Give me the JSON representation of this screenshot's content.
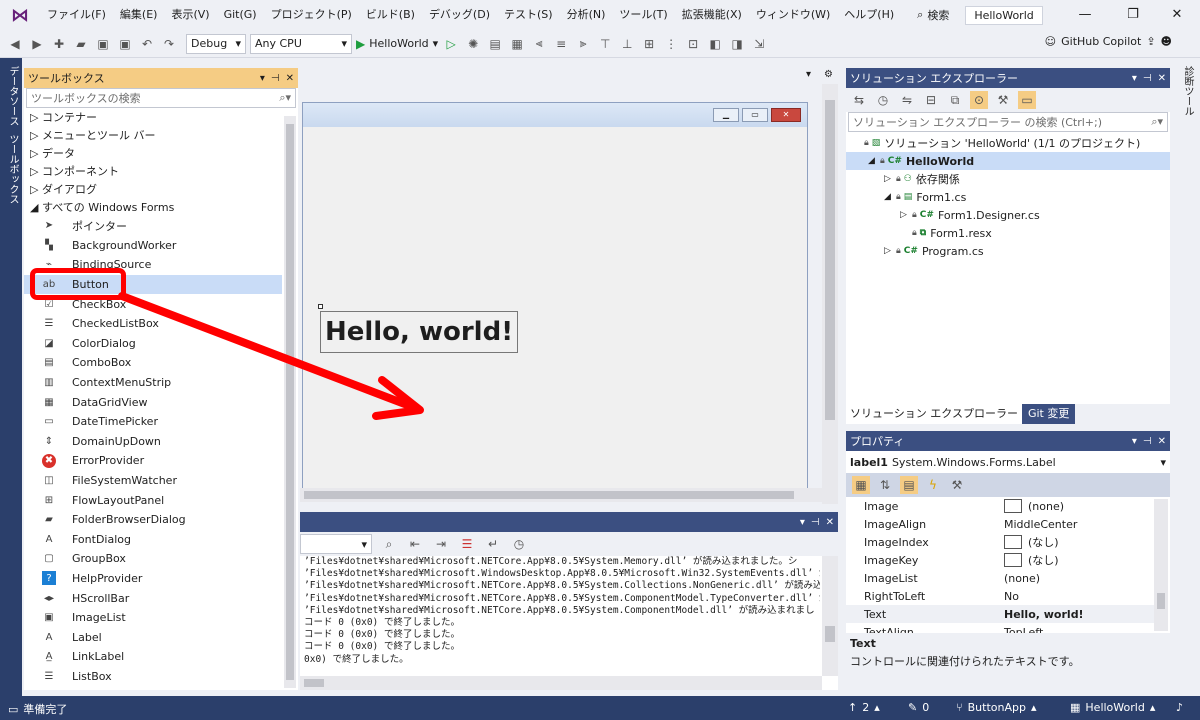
{
  "menu": {
    "items": [
      "ファイル(F)",
      "編集(E)",
      "表示(V)",
      "Git(G)",
      "プロジェクト(P)",
      "ビルド(B)",
      "デバッグ(D)",
      "テスト(S)",
      "分析(N)",
      "ツール(T)",
      "拡張機能(X)",
      "ウィンドウ(W)",
      "ヘルプ(H)"
    ],
    "search_label": "検索",
    "project_name": "HelloWorld"
  },
  "toolbar": {
    "config": "Debug",
    "platform": "Any CPU",
    "run_label": "HelloWorld",
    "copilot": "GitHub Copilot"
  },
  "left_strip": {
    "data_sources": "データソース",
    "toolbox": "ツールボックス"
  },
  "right_strip": {
    "diagnostic": "診断ツール"
  },
  "toolbox": {
    "title": "ツールボックス",
    "search_placeholder": "ツールボックスの検索",
    "categories": [
      "コンテナー",
      "メニューとツール バー",
      "データ",
      "コンポーネント",
      "ダイアログ"
    ],
    "group": "すべての Windows Forms",
    "items": [
      {
        "label": "ポインター",
        "icon": "pointer-icon"
      },
      {
        "label": "BackgroundWorker",
        "icon": "backgroundworker-icon"
      },
      {
        "label": "BindingSource",
        "icon": "bindingsource-icon"
      },
      {
        "label": "Button",
        "icon": "button-icon"
      },
      {
        "label": "CheckBox",
        "icon": "checkbox-icon"
      },
      {
        "label": "CheckedListBox",
        "icon": "checkedlistbox-icon"
      },
      {
        "label": "ColorDialog",
        "icon": "colordialog-icon"
      },
      {
        "label": "ComboBox",
        "icon": "combobox-icon"
      },
      {
        "label": "ContextMenuStrip",
        "icon": "contextmenustrip-icon"
      },
      {
        "label": "DataGridView",
        "icon": "datagridview-icon"
      },
      {
        "label": "DateTimePicker",
        "icon": "datetimepicker-icon"
      },
      {
        "label": "DomainUpDown",
        "icon": "domainupdown-icon"
      },
      {
        "label": "ErrorProvider",
        "icon": "errorprovider-icon"
      },
      {
        "label": "FileSystemWatcher",
        "icon": "filesystemwatcher-icon"
      },
      {
        "label": "FlowLayoutPanel",
        "icon": "flowlayoutpanel-icon"
      },
      {
        "label": "FolderBrowserDialog",
        "icon": "folderbrowserdialog-icon"
      },
      {
        "label": "FontDialog",
        "icon": "fontdialog-icon"
      },
      {
        "label": "GroupBox",
        "icon": "groupbox-icon"
      },
      {
        "label": "HelpProvider",
        "icon": "helpprovider-icon"
      },
      {
        "label": "HScrollBar",
        "icon": "hscrollbar-icon"
      },
      {
        "label": "ImageList",
        "icon": "imagelist-icon"
      },
      {
        "label": "Label",
        "icon": "label-icon"
      },
      {
        "label": "LinkLabel",
        "icon": "linklabel-icon"
      },
      {
        "label": "ListBox",
        "icon": "listbox-icon"
      }
    ]
  },
  "designer": {
    "label_text": "Hello, world!"
  },
  "output": {
    "lines": [
      "’Files¥dotnet¥shared¥Microsoft.NETCore.App¥8.0.5¥System.Memory.dll’ が読み込まれました。シ",
      "’Files¥dotnet¥shared¥Microsoft.WindowsDesktop.App¥8.0.5¥Microsoft.Win32.SystemEvents.dll’ が",
      "’Files¥dotnet¥shared¥Microsoft.NETCore.App¥8.0.5¥System.Collections.NonGeneric.dll’ が読み込",
      "’Files¥dotnet¥shared¥Microsoft.NETCore.App¥8.0.5¥System.ComponentModel.TypeConverter.dll’ が",
      "’Files¥dotnet¥shared¥Microsoft.NETCore.App¥8.0.5¥System.ComponentModel.dll’ が読み込まれまし",
      "コード 0 (0x0) で終了しました。",
      "コード 0 (0x0) で終了しました。",
      "コード 0 (0x0) で終了しました。",
      "0x0) で終了しました。"
    ]
  },
  "solution": {
    "title": "ソリューション エクスプローラー",
    "search_placeholder": "ソリューション エクスプローラー の検索 (Ctrl+;)",
    "tree": [
      {
        "label": "ソリューション 'HelloWorld' (1/1 のプロジェクト)",
        "indent": 0,
        "icon": "solution-icon"
      },
      {
        "label": "HelloWorld",
        "indent": 1,
        "icon": "csharp-project-icon",
        "bold": true
      },
      {
        "label": "依存関係",
        "indent": 2,
        "icon": "dependencies-icon"
      },
      {
        "label": "Form1.cs",
        "indent": 2,
        "icon": "form-icon"
      },
      {
        "label": "Form1.Designer.cs",
        "indent": 3,
        "icon": "csharp-file-icon"
      },
      {
        "label": "Form1.resx",
        "indent": 3,
        "icon": "resx-icon"
      },
      {
        "label": "Program.cs",
        "indent": 2,
        "icon": "csharp-file-icon"
      }
    ],
    "tabs": [
      "ソリューション エクスプローラー",
      "Git 変更"
    ]
  },
  "properties": {
    "title": "プロパティ",
    "object": "label1",
    "object_type": "System.Windows.Forms.Label",
    "rows": [
      {
        "name": "Image",
        "value": "(none)",
        "swatch": true
      },
      {
        "name": "ImageAlign",
        "value": "MiddleCenter",
        "swatch": false
      },
      {
        "name": "ImageIndex",
        "value": "(なし)",
        "swatch": true
      },
      {
        "name": "ImageKey",
        "value": "(なし)",
        "swatch": true
      },
      {
        "name": "ImageList",
        "value": "(none)",
        "swatch": false
      },
      {
        "name": "RightToLeft",
        "value": "No",
        "swatch": false
      },
      {
        "name": "Text",
        "value": "Hello, world!",
        "swatch": false,
        "bold": true
      },
      {
        "name": "TextAlign",
        "value": "TopLeft",
        "swatch": false
      }
    ],
    "desc_title": "Text",
    "desc_text": "コントロールに関連付けられたテキストです。"
  },
  "status": {
    "ready": "準備完了",
    "up_count": "2",
    "edit_count": "0",
    "branch": "ButtonApp",
    "repo": "HelloWorld"
  },
  "colors": {
    "accent": "#2b3f6b",
    "toolbox_title": "#f5cc84",
    "selection": "#c9dcf7",
    "annotation": "#ff0000"
  }
}
